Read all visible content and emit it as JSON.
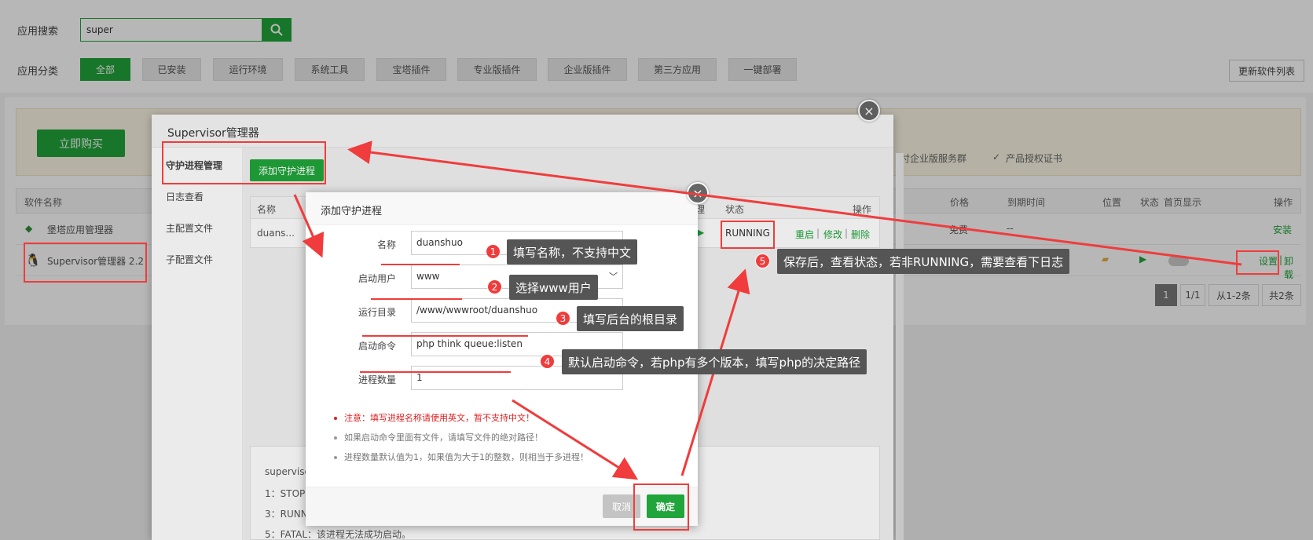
{
  "header": {
    "search_label": "应用搜索",
    "search_value": "super",
    "category_label": "应用分类",
    "categories": [
      "全部",
      "已安装",
      "运行环境",
      "系统工具",
      "宝塔插件",
      "专业版插件",
      "企业版插件",
      "第三方应用",
      "一键部署"
    ],
    "refresh_button": "更新软件列表"
  },
  "banner": {
    "buy_button": "立即购买",
    "feature1": "付企业版服务群",
    "feature2": "产品授权证书"
  },
  "table": {
    "col_name": "软件名称",
    "col_price": "价格",
    "col_expire": "到期时间",
    "col_location": "位置",
    "col_status": "状态",
    "col_home": "首页显示",
    "col_ops": "操作",
    "rows": [
      {
        "name": "堡塔应用管理器",
        "price": "免费",
        "expire": "--",
        "action": "安装"
      },
      {
        "name": "Supervisor管理器 2.2",
        "action1": "设置",
        "sep": "|",
        "action2": "卸载"
      }
    ]
  },
  "pager": {
    "current": "1",
    "total": "1/1",
    "range": "从1-2条",
    "count": "共2条"
  },
  "supervisor": {
    "title": "Supervisor管理器",
    "menu": [
      "守护进程管理",
      "日志查看",
      "主配置文件",
      "子配置文件"
    ],
    "add_button": "添加守护进程",
    "table_col_name": "名称",
    "table_col_manage": "理",
    "table_col_status": "状态",
    "table_col_ops": "操作",
    "row_name": "duans...",
    "row_status": "RUNNING",
    "row_restart": "重启",
    "row_edit": "修改",
    "row_delete": "删除",
    "bottom_lines": [
      "supervisor",
      "1：STOP",
      "3：RUNN",
      "5：FATAL：该进程无法成功启动。"
    ]
  },
  "dialog": {
    "title": "添加守护进程",
    "fields": [
      {
        "label": "名称",
        "value": "duanshuo"
      },
      {
        "label": "启动用户",
        "value": "www"
      },
      {
        "label": "运行目录",
        "value": "/www/wwwroot/duanshuo"
      },
      {
        "label": "启动命令",
        "value": "php think queue:listen"
      },
      {
        "label": "进程数量",
        "value": "1"
      }
    ],
    "notes": [
      "注意：填写进程名称请使用英文，暂不支持中文！",
      "如果启动命令里面有文件，请填写文件的绝对路径！",
      "进程数量默认值为1，如果值为大于1的整数，则相当于多进程！"
    ],
    "cancel": "取消",
    "confirm": "确定"
  },
  "annotations": [
    {
      "num": "1",
      "text": "填写名称，不支持中文"
    },
    {
      "num": "2",
      "text": "选择www用户"
    },
    {
      "num": "3",
      "text": "填写后台的根目录"
    },
    {
      "num": "4",
      "text": "默认启动命令，若php有多个版本，填写php的决定路径"
    },
    {
      "num": "5",
      "text": "保存后，查看状态，若非RUNNING，需要查看下日志"
    }
  ],
  "colors": {
    "brand_green": "#20a53a",
    "annotation_red": "#f03c3c",
    "tooltip_bg": "#555555"
  }
}
